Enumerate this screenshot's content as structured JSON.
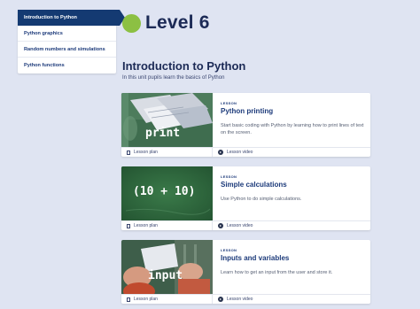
{
  "sidebar": {
    "items": [
      {
        "label": "Introduction to Python"
      },
      {
        "label": "Python graphics"
      },
      {
        "label": "Random numbers and simulations"
      },
      {
        "label": "Python functions"
      }
    ]
  },
  "header": {
    "level_title": "Level 6",
    "level_color": "#8cc043"
  },
  "unit": {
    "title": "Introduction to Python",
    "subtitle": "In this unit pupils learn the basics of Python"
  },
  "lessons": [
    {
      "tag": "LESSON",
      "title": "Python printing",
      "description": "Start basic coding with Python by learning how to print lines of text on the screen.",
      "image_text": "print",
      "plan_label": "Lesson plan",
      "video_label": "Lesson video"
    },
    {
      "tag": "LESSON",
      "title": "Simple calculations",
      "description": "Use Python to do simple calculations.",
      "image_text": "(10 + 10)",
      "plan_label": "Lesson plan",
      "video_label": "Lesson video"
    },
    {
      "tag": "LESSON",
      "title": "Inputs and variables",
      "description": "Learn how to get an input from the user and store it.",
      "image_text": "input",
      "plan_label": "Lesson plan",
      "video_label": "Lesson video"
    }
  ],
  "colors": {
    "navy": "#143a72",
    "background": "#dfe4f2",
    "chalkboard": "#2f6b3e"
  }
}
